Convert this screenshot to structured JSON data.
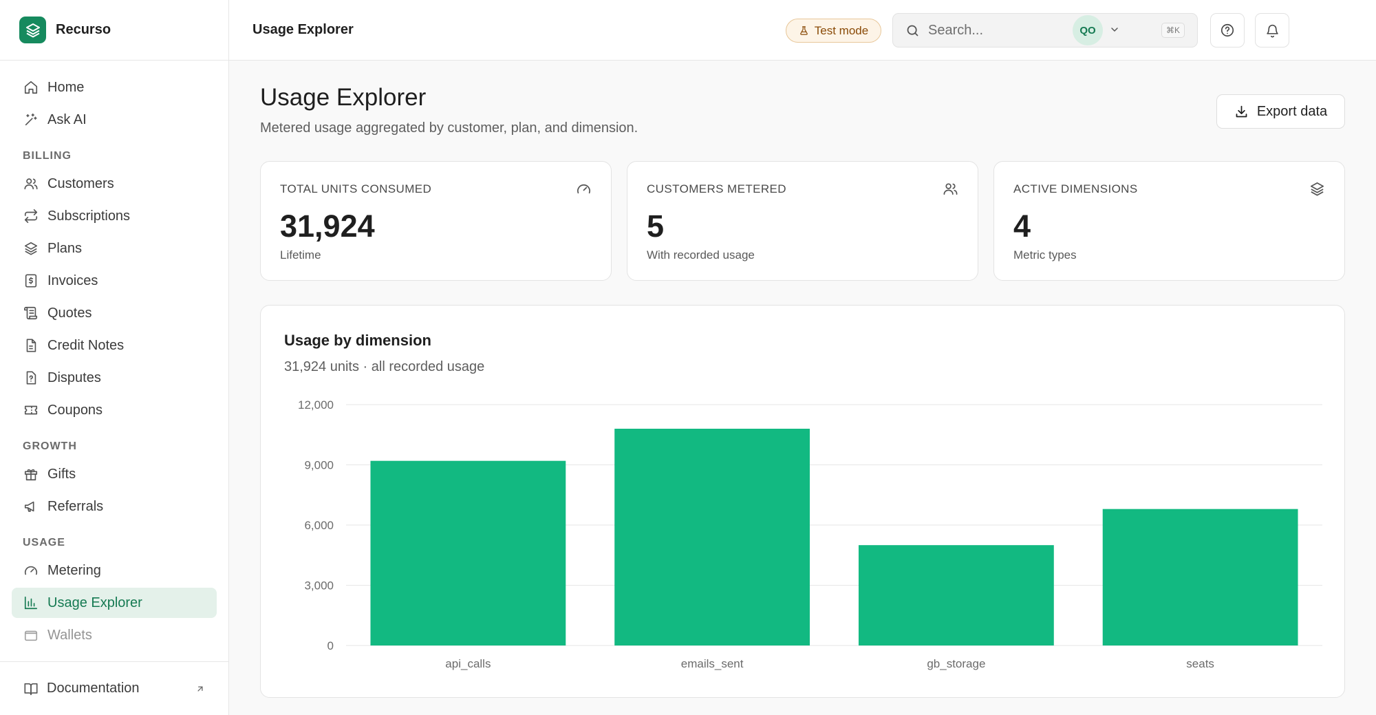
{
  "app": {
    "name": "Recurso"
  },
  "sidebar": {
    "top_items": [
      {
        "label": "Home",
        "icon": "home-icon"
      },
      {
        "label": "Ask AI",
        "icon": "sparkles-icon"
      }
    ],
    "sections": [
      {
        "title": "BILLING",
        "items": [
          {
            "label": "Customers",
            "icon": "users-icon"
          },
          {
            "label": "Subscriptions",
            "icon": "repeat-icon"
          },
          {
            "label": "Plans",
            "icon": "layers-icon"
          },
          {
            "label": "Invoices",
            "icon": "receipt-dollar-icon"
          },
          {
            "label": "Quotes",
            "icon": "scroll-icon"
          },
          {
            "label": "Credit Notes",
            "icon": "file-icon"
          },
          {
            "label": "Disputes",
            "icon": "file-question-icon"
          },
          {
            "label": "Coupons",
            "icon": "ticket-icon"
          }
        ]
      },
      {
        "title": "GROWTH",
        "items": [
          {
            "label": "Gifts",
            "icon": "gift-icon"
          },
          {
            "label": "Referrals",
            "icon": "megaphone-icon"
          }
        ]
      },
      {
        "title": "USAGE",
        "items": [
          {
            "label": "Metering",
            "icon": "gauge-icon"
          },
          {
            "label": "Usage Explorer",
            "icon": "bar-chart-icon",
            "active": true
          },
          {
            "label": "Wallets",
            "icon": "wallet-icon"
          }
        ]
      }
    ],
    "footer": {
      "label": "Documentation",
      "icon": "book-icon"
    }
  },
  "topbar": {
    "title": "Usage Explorer",
    "test_mode_label": "Test mode",
    "search_placeholder": "Search...",
    "search_shortcut": "⌘K",
    "avatar_initials": "QO"
  },
  "page": {
    "title": "Usage Explorer",
    "subtitle": "Metered usage aggregated by customer, plan, and dimension.",
    "export_label": "Export data"
  },
  "stats": [
    {
      "label": "TOTAL UNITS CONSUMED",
      "value": "31,924",
      "note": "Lifetime",
      "icon": "gauge-icon"
    },
    {
      "label": "CUSTOMERS METERED",
      "value": "5",
      "note": "With recorded usage",
      "icon": "users-icon"
    },
    {
      "label": "ACTIVE DIMENSIONS",
      "value": "4",
      "note": "Metric types",
      "icon": "layers-icon"
    }
  ],
  "chart_card": {
    "title": "Usage by dimension",
    "subtitle": "31,924 units · all recorded usage"
  },
  "chart_data": {
    "type": "bar",
    "categories": [
      "api_calls",
      "emails_sent",
      "gb_storage",
      "seats"
    ],
    "values": [
      9200,
      10800,
      5000,
      6800
    ],
    "ylim": [
      0,
      12000
    ],
    "yticks": [
      0,
      3000,
      6000,
      9000,
      12000
    ],
    "ytick_labels": [
      "0",
      "3,000",
      "6,000",
      "9,000",
      "12,000"
    ],
    "bar_color": "#12b981",
    "grid": true
  },
  "colors": {
    "accent": "#157a52",
    "brand": "#168a5e",
    "active_bg": "#e4f1ea"
  }
}
